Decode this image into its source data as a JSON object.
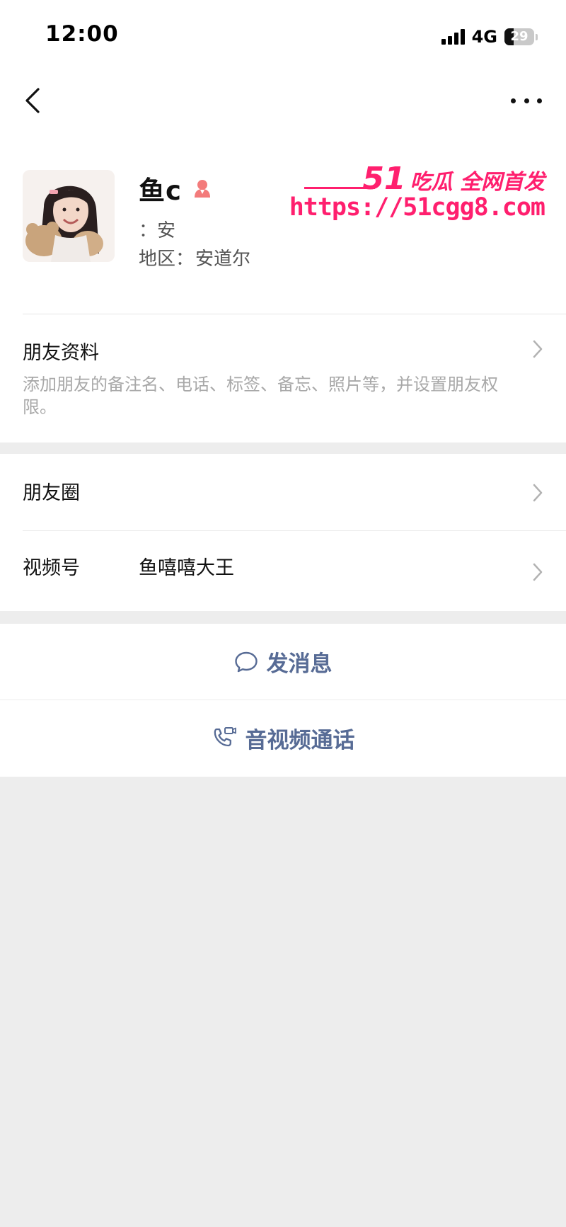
{
  "status_bar": {
    "time": "12:00",
    "network": "4G",
    "battery": "29"
  },
  "nav": {
    "back_icon": "chevron-left-icon",
    "more_icon": "more-dots-icon"
  },
  "profile": {
    "name": "鱼c",
    "gender": "female",
    "wechat_id": "：安",
    "region_label": "地区：",
    "region_value": "安道尔"
  },
  "watermark": {
    "title_num": "51",
    "title_text": "吃瓜 全网首发",
    "url": "https://51cgg8.com"
  },
  "friend_info": {
    "title": "朋友资料",
    "description": "添加朋友的备注名、电话、标签、备忘、照片等，并设置朋友权限。"
  },
  "list": {
    "moments_label": "朋友圈",
    "channels_label": "视频号",
    "channels_value": "鱼嘻嘻大王"
  },
  "actions": {
    "message_label": "发消息",
    "call_label": "音视频通话"
  },
  "colors": {
    "link_blue": "#576b95",
    "watermark_pink": "#ff1f6e",
    "female_icon": "#f37b7b",
    "background": "#ededed"
  }
}
